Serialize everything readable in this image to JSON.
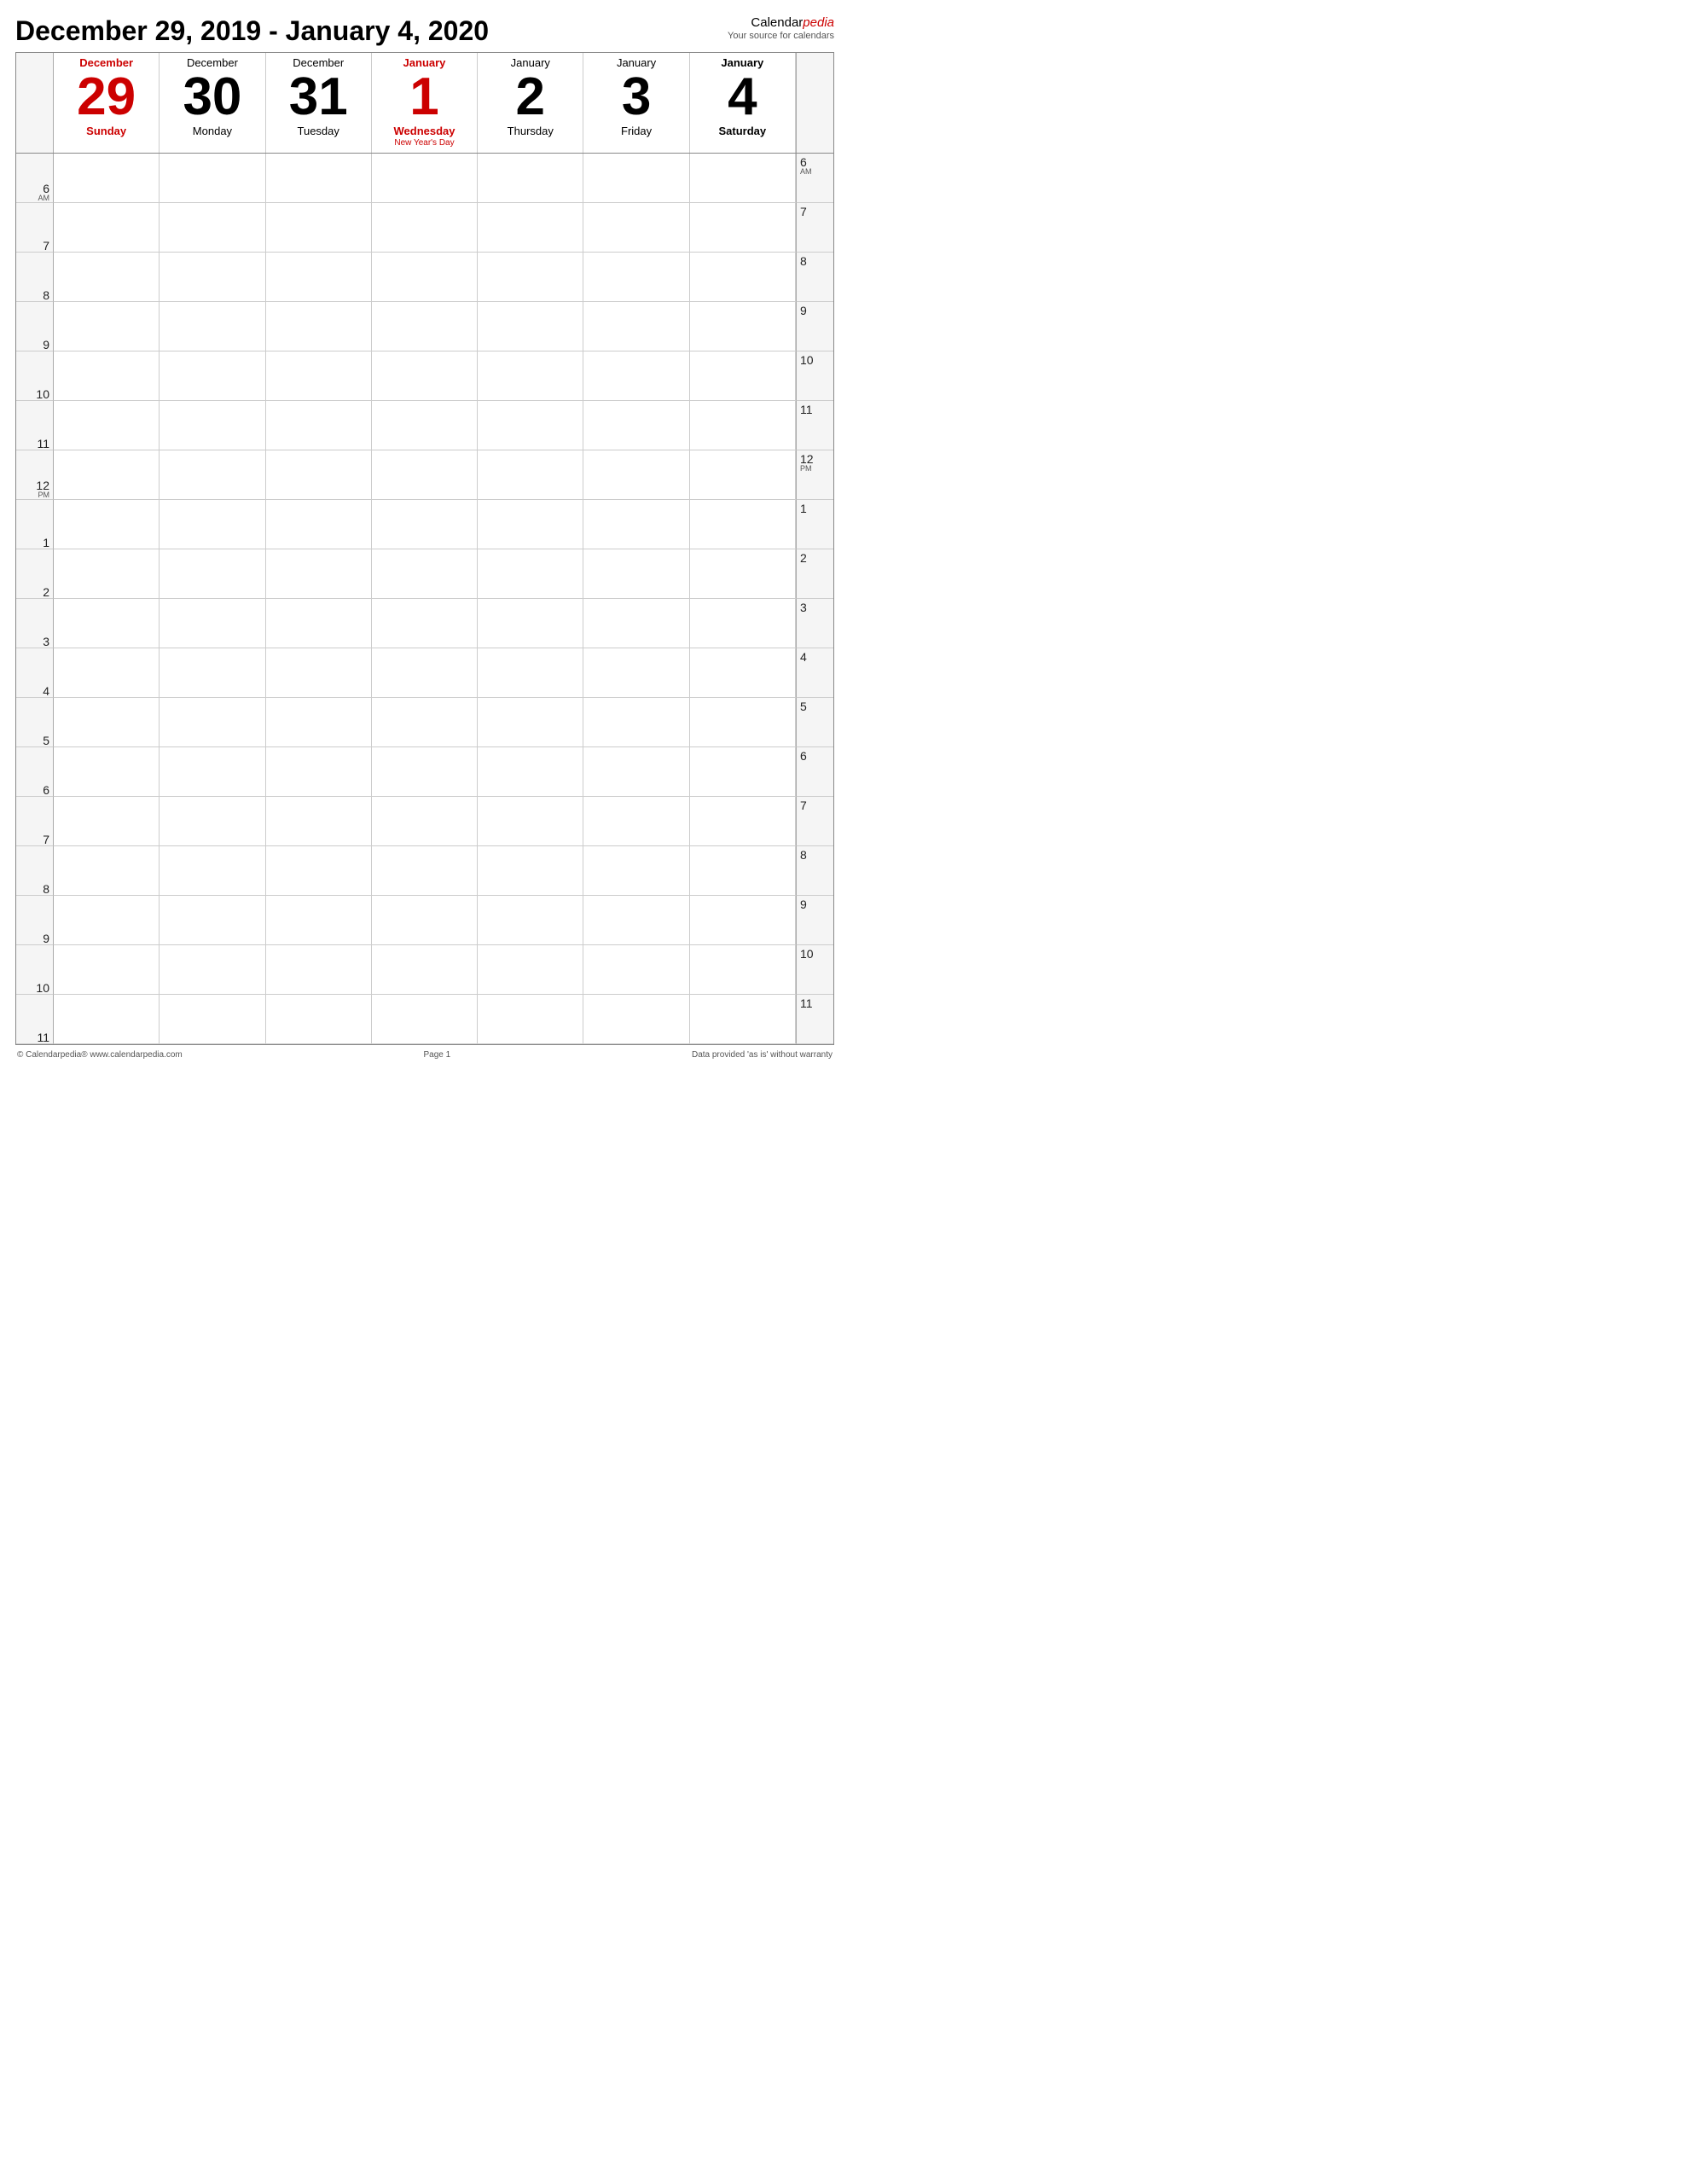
{
  "header": {
    "title": "December 29, 2019 - January 4, 2020",
    "brand_name_prefix": "Calendar",
    "brand_name_suffix": "pedia",
    "brand_tagline": "Your source for calendars"
  },
  "days": [
    {
      "id": "dec29",
      "month": "December",
      "month_class": "red",
      "num": "29",
      "num_class": "red",
      "weekday": "Sunday",
      "weekday_class": "red",
      "holiday": ""
    },
    {
      "id": "dec30",
      "month": "December",
      "month_class": "",
      "num": "30",
      "num_class": "",
      "weekday": "Monday",
      "weekday_class": "",
      "holiday": ""
    },
    {
      "id": "dec31",
      "month": "December",
      "month_class": "",
      "num": "31",
      "num_class": "",
      "weekday": "Tuesday",
      "weekday_class": "",
      "holiday": ""
    },
    {
      "id": "jan1",
      "month": "January",
      "month_class": "red",
      "num": "1",
      "num_class": "red",
      "weekday": "Wednesday",
      "weekday_class": "red",
      "holiday": "New Year's Day"
    },
    {
      "id": "jan2",
      "month": "January",
      "month_class": "",
      "num": "2",
      "num_class": "",
      "weekday": "Thursday",
      "weekday_class": "",
      "holiday": ""
    },
    {
      "id": "jan3",
      "month": "January",
      "month_class": "",
      "num": "3",
      "num_class": "",
      "weekday": "Friday",
      "weekday_class": "",
      "holiday": ""
    },
    {
      "id": "jan4",
      "month": "January",
      "month_class": "bold",
      "num": "4",
      "num_class": "bold-black",
      "weekday": "Saturday",
      "weekday_class": "bold",
      "holiday": ""
    }
  ],
  "time_slots": [
    {
      "label": "6",
      "sub": "AM",
      "right_label": "6",
      "right_sub": "AM"
    },
    {
      "label": "7",
      "sub": "",
      "right_label": "7",
      "right_sub": ""
    },
    {
      "label": "8",
      "sub": "",
      "right_label": "8",
      "right_sub": ""
    },
    {
      "label": "9",
      "sub": "",
      "right_label": "9",
      "right_sub": ""
    },
    {
      "label": "10",
      "sub": "",
      "right_label": "10",
      "right_sub": ""
    },
    {
      "label": "11",
      "sub": "",
      "right_label": "11",
      "right_sub": ""
    },
    {
      "label": "12",
      "sub": "PM",
      "right_label": "12",
      "right_sub": "PM"
    },
    {
      "label": "1",
      "sub": "",
      "right_label": "1",
      "right_sub": ""
    },
    {
      "label": "2",
      "sub": "",
      "right_label": "2",
      "right_sub": ""
    },
    {
      "label": "3",
      "sub": "",
      "right_label": "3",
      "right_sub": ""
    },
    {
      "label": "4",
      "sub": "",
      "right_label": "4",
      "right_sub": ""
    },
    {
      "label": "5",
      "sub": "",
      "right_label": "5",
      "right_sub": ""
    },
    {
      "label": "6",
      "sub": "",
      "right_label": "6",
      "right_sub": ""
    },
    {
      "label": "7",
      "sub": "",
      "right_label": "7",
      "right_sub": ""
    },
    {
      "label": "8",
      "sub": "",
      "right_label": "8",
      "right_sub": ""
    },
    {
      "label": "9",
      "sub": "",
      "right_label": "9",
      "right_sub": ""
    },
    {
      "label": "10",
      "sub": "",
      "right_label": "10",
      "right_sub": ""
    },
    {
      "label": "11",
      "sub": "",
      "right_label": "11",
      "right_sub": ""
    }
  ],
  "footer": {
    "left": "© Calendarpedia®  www.calendarpedia.com",
    "center": "Page 1",
    "right": "Data provided 'as is' without warranty"
  }
}
